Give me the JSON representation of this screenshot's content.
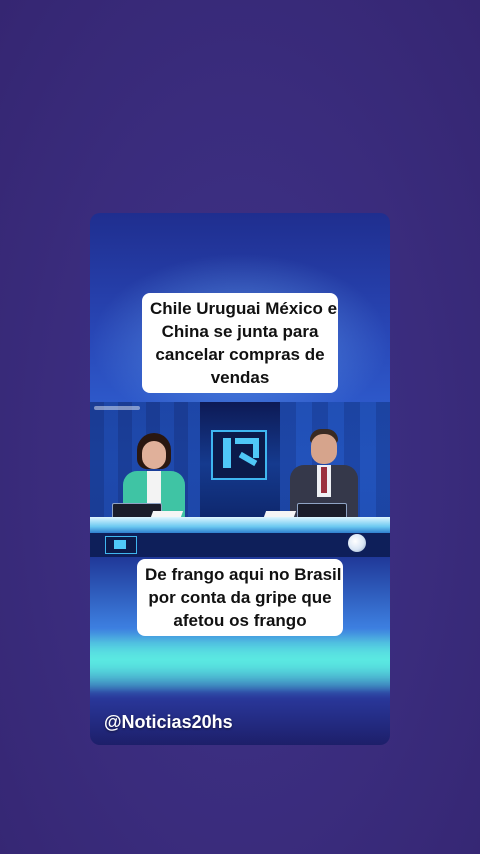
{
  "caption_top": {
    "lines": [
      "Chile Uruguai México e",
      "China se junta para",
      "cancelar compras de",
      "vendas"
    ]
  },
  "caption_bottom": {
    "lines": [
      "De frango aqui no Brasil",
      "por conta da gripe que",
      "afetou os frango"
    ]
  },
  "handle": "@Noticias20hs",
  "colors": {
    "background": "#3a2d7c",
    "caption_bg": "#ffffff",
    "accent_cyan": "#5ad9e0"
  }
}
